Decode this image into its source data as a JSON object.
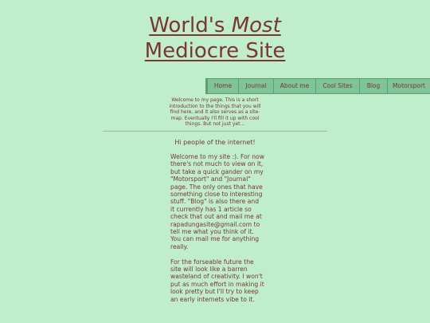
{
  "header": {
    "title_part1": "World's ",
    "title_emphasis": "Most",
    "title_line2": "Mediocre Site"
  },
  "nav": {
    "items": [
      {
        "label": "Home"
      },
      {
        "label": "Journal"
      },
      {
        "label": "About me"
      },
      {
        "label": "Cool Sites"
      },
      {
        "label": "Blog"
      },
      {
        "label": "Motorsport"
      }
    ]
  },
  "intro": {
    "text": "Welcome to my page. This is a short introduction to the things that you will find here, and it also serves as a site-map. Eventually I'll fill it up with cool things. But not just yet..."
  },
  "main": {
    "greeting": "Hi people of the internet!",
    "paragraph1": "Welcome to my site :). For now there's not much to view on it, but take a quick gander on my \"Motorsport\" and \"Journal\" page. The only ones that have something close to interesting stuff. \"Blog\" is also there and it currently has 1 article so check that out and mail me at rapadungasite@gmail.com to tell me what you think of it. You can mail me for anything really.",
    "paragraph2": "For the forseable future the site will look like a barren wasteland of creativity. I won't put as much effort in making it look pretty but I'll try to keep an early internets vibe to it."
  },
  "colors": {
    "background": "#c0edca",
    "text": "#7a3535",
    "nav_background": "#7fc496"
  }
}
